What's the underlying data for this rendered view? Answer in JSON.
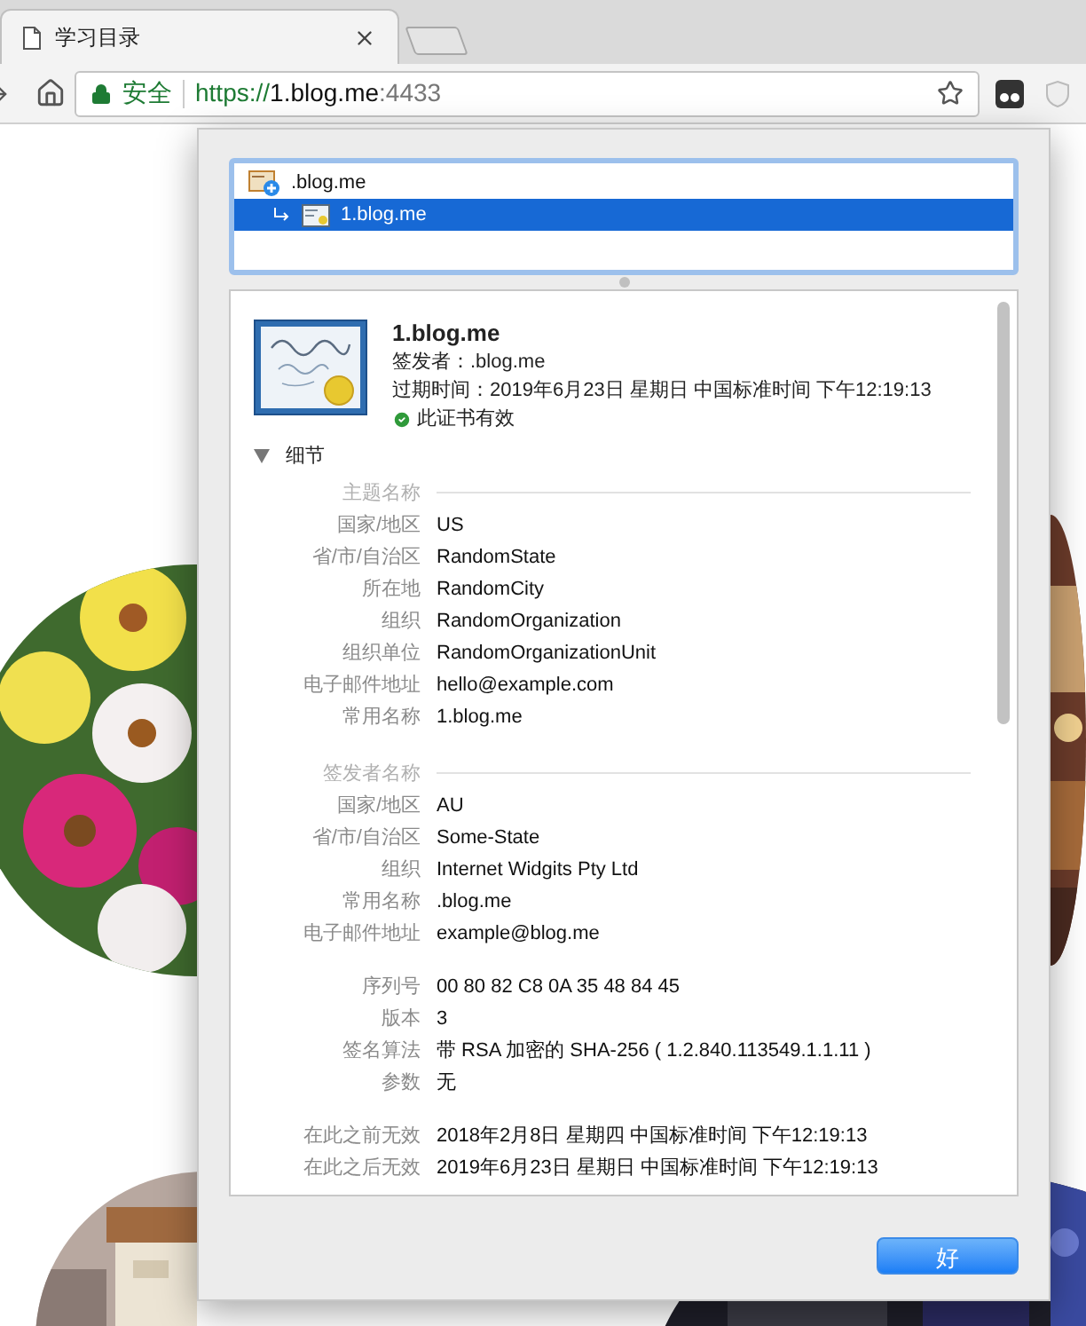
{
  "tab": {
    "title": "学习目录"
  },
  "address_bar": {
    "security_label": "安全",
    "url_scheme": "https://",
    "url_host": "1.blog.me",
    "url_port": ":4433"
  },
  "cert_tree": [
    {
      "name": ".blog.me",
      "selected": false,
      "children": [
        {
          "name": "1.blog.me",
          "selected": true
        }
      ]
    }
  ],
  "certificate": {
    "name": "1.blog.me",
    "issuer": "签发者：.blog.me",
    "expires": "过期时间：2019年6月23日 星期日 中国标准时间 下午12:19:13",
    "status": "此证书有效",
    "valid": true
  },
  "details": {
    "label": "细节",
    "expanded": true,
    "sections": [
      {
        "heading": "主题名称",
        "rows": [
          {
            "label": "国家/地区",
            "value": "US"
          },
          {
            "label": "省/市/自治区",
            "value": "RandomState"
          },
          {
            "label": "所在地",
            "value": "RandomCity"
          },
          {
            "label": "组织",
            "value": "RandomOrganization"
          },
          {
            "label": "组织单位",
            "value": "RandomOrganizationUnit"
          },
          {
            "label": "电子邮件地址",
            "value": "hello@example.com"
          },
          {
            "label": "常用名称",
            "value": "1.blog.me"
          }
        ]
      },
      {
        "heading": "签发者名称",
        "rows": [
          {
            "label": "国家/地区",
            "value": "AU"
          },
          {
            "label": "省/市/自治区",
            "value": "Some-State"
          },
          {
            "label": "组织",
            "value": "Internet Widgits Pty Ltd"
          },
          {
            "label": "常用名称",
            "value": ".blog.me"
          },
          {
            "label": "电子邮件地址",
            "value": "example@blog.me"
          }
        ]
      },
      {
        "rows": [
          {
            "label": "序列号",
            "value": "00 80 82 C8 0A 35 48 84 45"
          },
          {
            "label": "版本",
            "value": "3"
          },
          {
            "label": "签名算法",
            "value": "带 RSA 加密的 SHA-256 ( 1.2.840.113549.1.1.11 )"
          },
          {
            "label": "参数",
            "value": "无"
          }
        ]
      },
      {
        "rows": [
          {
            "label": "在此之前无效",
            "value": "2018年2月8日 星期四 中国标准时间 下午12:19:13"
          },
          {
            "label": "在此之后无效",
            "value": "2019年6月23日 星期日 中国标准时间 下午12:19:13"
          }
        ]
      }
    ]
  },
  "ok_button": "好"
}
